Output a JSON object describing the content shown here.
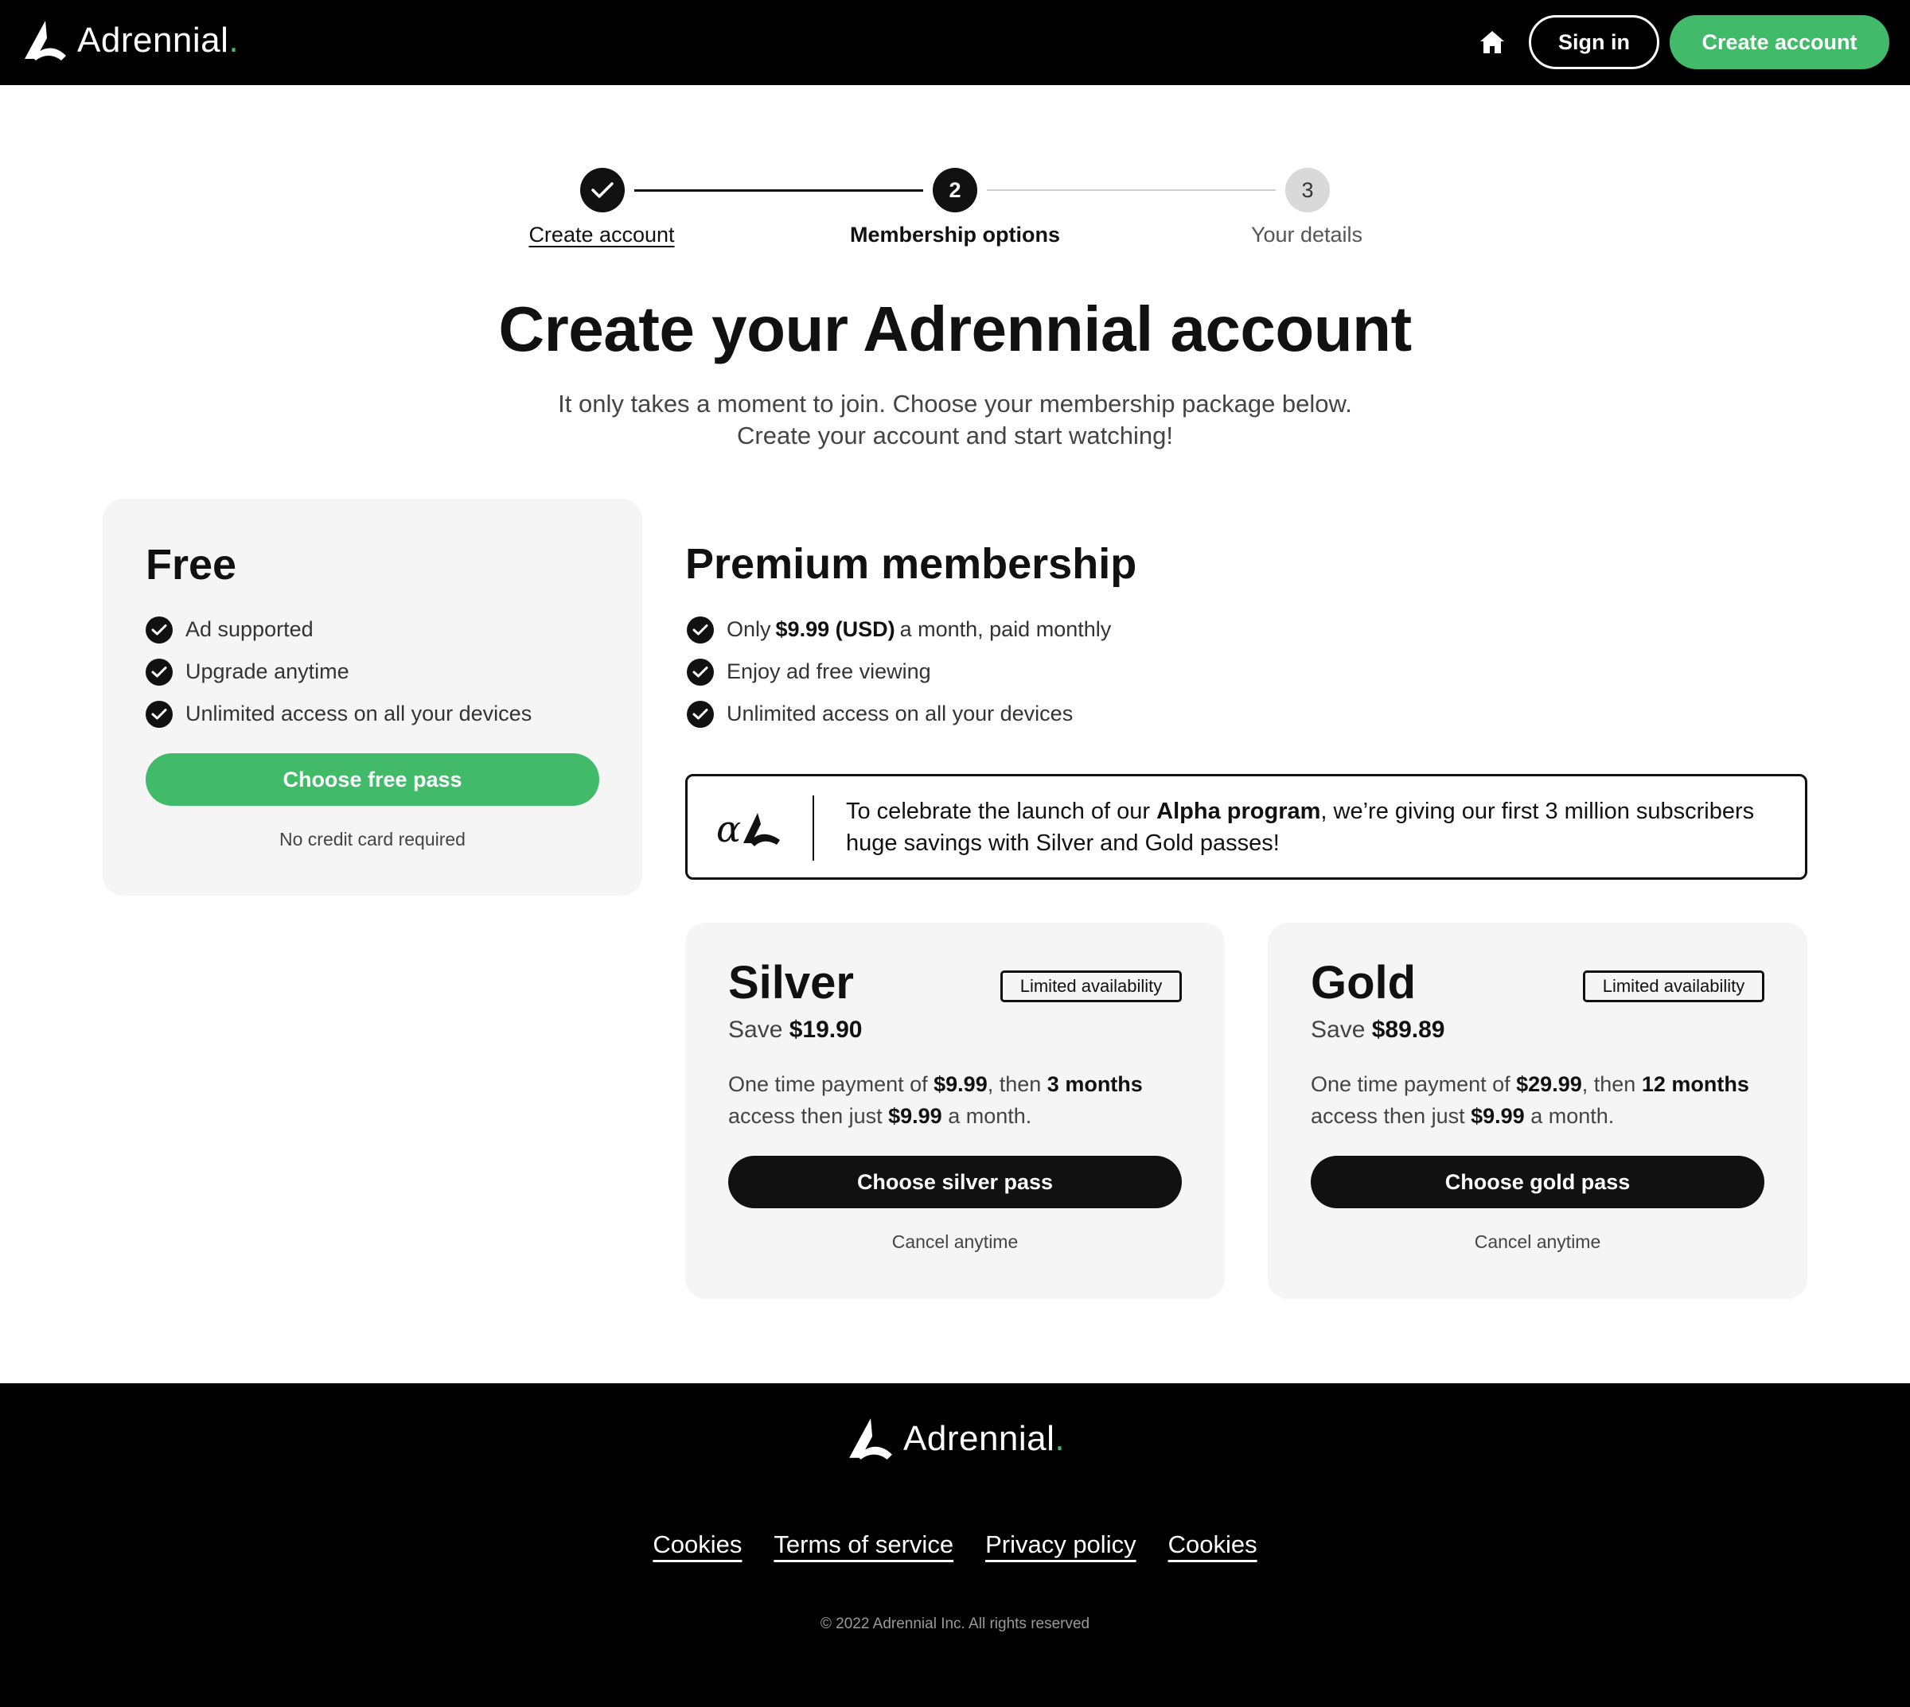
{
  "brand": {
    "name": "Adrennial",
    "accent_color": "#41bb6a",
    "dark_color": "#111111"
  },
  "header": {
    "home_icon": "home-icon",
    "sign_in_label": "Sign in",
    "create_account_label": "Create account"
  },
  "stepper": {
    "steps": [
      {
        "number": "",
        "label": "Create account",
        "state": "completed"
      },
      {
        "number": "2",
        "label": "Membership options",
        "state": "current"
      },
      {
        "number": "3",
        "label": "Your details",
        "state": "upcoming"
      }
    ]
  },
  "page": {
    "title": "Create your Adrennial account",
    "subtitle": "It only takes a moment to join. Choose your membership package below. Create your account and start watching!"
  },
  "free_plan": {
    "title": "Free",
    "features": [
      "Ad supported",
      "Upgrade anytime",
      "Unlimited access on all your devices"
    ],
    "button_label": "Choose free pass",
    "note": "No credit card required"
  },
  "premium": {
    "title": "Premium membership",
    "feature1_pre": "Only",
    "feature1_price": "$9.99 (USD)",
    "feature1_post": "a month, paid monthly",
    "feature2": "Enjoy ad free viewing",
    "feature3": "Unlimited access on all your devices",
    "promo": {
      "text_pre": "To celebrate the launch of our",
      "text_bold": "Alpha program",
      "text_post": ", we’re giving our first 3 million subscribers huge savings with Silver and Gold passes!"
    }
  },
  "tiers": [
    {
      "title": "Silver",
      "badge": "Limited availability",
      "save_label": "Save",
      "save_amount": "$19.90",
      "desc_1": "One time payment of",
      "payment": "$9.99",
      "desc_2": ", then",
      "duration": "3 months",
      "desc_3": "access then just",
      "monthly": "$9.99",
      "desc_4": "a month.",
      "button_label": "Choose silver pass",
      "note": "Cancel anytime"
    },
    {
      "title": "Gold",
      "badge": "Limited availability",
      "save_label": "Save",
      "save_amount": "$89.89",
      "desc_1": "One time payment of",
      "payment": "$29.99",
      "desc_2": ", then",
      "duration": "12 months",
      "desc_3": "access then just",
      "monthly": "$9.99",
      "desc_4": "a month.",
      "button_label": "Choose gold pass",
      "note": "Cancel anytime"
    }
  ],
  "footer": {
    "links": [
      "Cookies",
      "Terms of service",
      "Privacy policy",
      "Cookies"
    ],
    "copyright": "© 2022 Adrennial Inc. All rights reserved"
  }
}
